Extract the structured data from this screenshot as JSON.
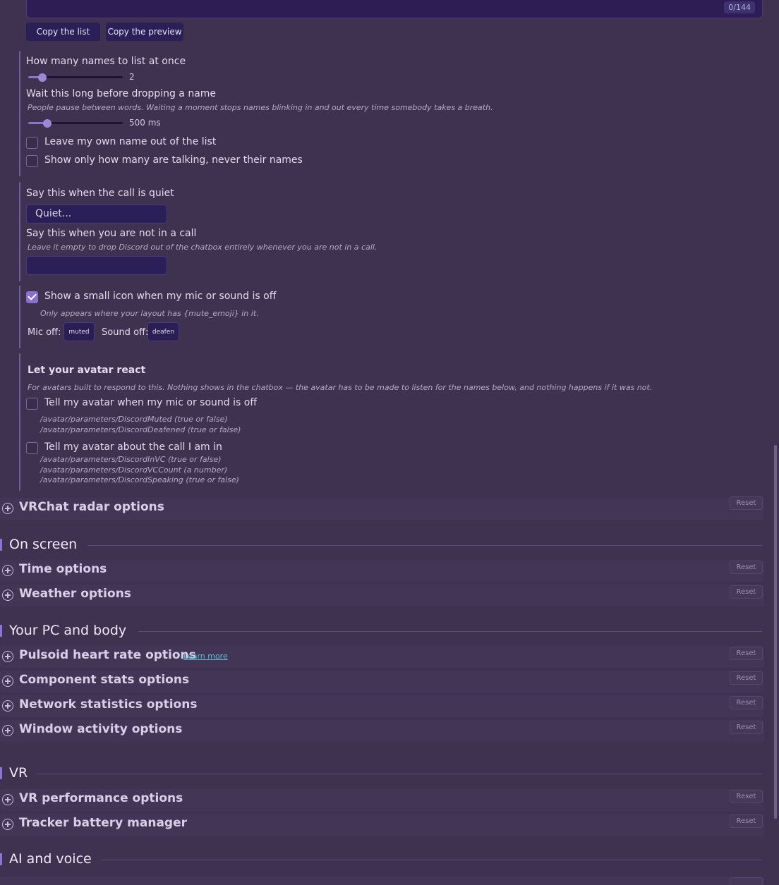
{
  "top": {
    "counter": "0/144",
    "copy_list": "Copy the list",
    "copy_preview": "Copy the preview"
  },
  "names": {
    "count_label": "How many names to list at once",
    "count_value": "2",
    "count_fraction": 0.15,
    "wait_label": "Wait this long before dropping a name",
    "wait_hint": "People pause between words. Waiting a moment stops names blinking in and out every time somebody takes a breath.",
    "wait_value": "500 ms",
    "wait_fraction": 0.2,
    "leave_own": "Leave my own name out of the list",
    "only_count": "Show only how many are talking, never their names"
  },
  "messages": {
    "quiet_label": "Say this when the call is quiet",
    "quiet_value": "Quiet...",
    "not_in_call_label": "Say this when you are not in a call",
    "not_in_call_hint": "Leave it empty to drop Discord out of the chatbox entirely whenever you are not in a call.",
    "not_in_call_value": ""
  },
  "mute": {
    "icon_label": "Show a small icon when my mic or sound is off",
    "icon_checked": true,
    "icon_hint": "Only appears where your layout has {mute_emoji} in it.",
    "mic_off_label": "Mic off:",
    "mic_off_value": "muted",
    "sound_off_label": "Sound off:",
    "sound_off_value": "deafen"
  },
  "avatar": {
    "title": "Let your avatar react",
    "hint": "For avatars built to respond to this. Nothing shows in the chatbox — the avatar has to be made to listen for the names below, and nothing happens if it was not.",
    "mute_label": "Tell my avatar when my mic or sound is off",
    "mute_params": [
      "/avatar/parameters/DiscordMuted (true or false)",
      "/avatar/parameters/DiscordDeafened (true or false)"
    ],
    "call_label": "Tell my avatar about the call I am in",
    "call_params": [
      "/avatar/parameters/DiscordInVC (true or false)",
      "/avatar/parameters/DiscordVCCount (a number)",
      "/avatar/parameters/DiscordSpeaking (true or false)"
    ]
  },
  "reset_label": "Reset",
  "learn_more": "Learn more",
  "sections": {
    "vrchat_radar": "VRChat radar options",
    "on_screen": "On screen",
    "time": "Time options",
    "weather": "Weather options",
    "pc_body": "Your PC and body",
    "pulsoid": "Pulsoid heart rate options",
    "component": "Component stats options",
    "network": "Network statistics options",
    "window": "Window activity options",
    "vr": "VR",
    "vr_perf": "VR performance options",
    "tracker": "Tracker battery manager",
    "ai_voice": "AI and voice"
  }
}
